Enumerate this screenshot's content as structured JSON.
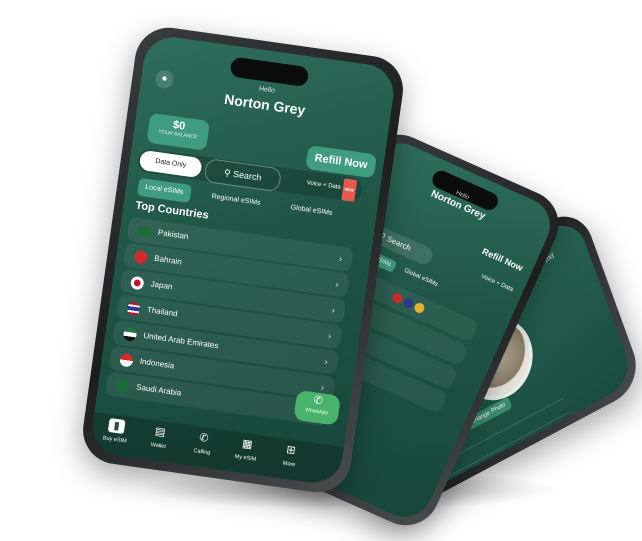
{
  "colors": {
    "accent": "#3f9c80",
    "screen_dark": "#1f5446",
    "whatsapp": "#47b36b",
    "badge": "#e65a4d"
  },
  "front": {
    "hello": "Hello",
    "name": "Norton Grey",
    "balance_amount": "$0",
    "balance_label": "YOUR BALANCE",
    "refill": "Refill Now",
    "data_only": "Data Only",
    "search": "Search",
    "voice_data": "Voice + Data",
    "voice_badge": "NEW",
    "tabs": [
      "Local eSIMs",
      "Regional eSIMs",
      "Global eSIMs"
    ],
    "top_countries": "Top Countries",
    "countries": [
      {
        "name": "Pakistan",
        "flag": "#1e6b3a"
      },
      {
        "name": "Bahrain",
        "flag": "#d02c2c"
      },
      {
        "name": "Japan",
        "flag": "#ffffff"
      },
      {
        "name": "Thailand",
        "flag": "#2d3a8c"
      },
      {
        "name": "United Arab Emirates",
        "flag": "#1e7a3a"
      },
      {
        "name": "Indonesia",
        "flag": "#d02c2c"
      },
      {
        "name": "Saudi Arabia",
        "flag": "#1e6b3a"
      }
    ],
    "whatsapp": "WhatsApp",
    "nav": [
      {
        "label": "Buy eSIM",
        "icon": "sim-card-icon"
      },
      {
        "label": "Wallet",
        "icon": "wallet-icon"
      },
      {
        "label": "Calling",
        "icon": "phone-icon"
      },
      {
        "label": "My eSIM",
        "icon": "my-esim-icon"
      },
      {
        "label": "More",
        "icon": "grid-icon"
      }
    ]
  },
  "middle": {
    "hello": "Hello",
    "name": "Norton Grey",
    "refill": "Refill Now",
    "search": "Search",
    "voice_data": "Voice + Data",
    "tabs": [
      "Regional eSIMs",
      "Global eSIMs"
    ]
  },
  "back": {
    "next": "Next",
    "button": "Change Photo"
  }
}
